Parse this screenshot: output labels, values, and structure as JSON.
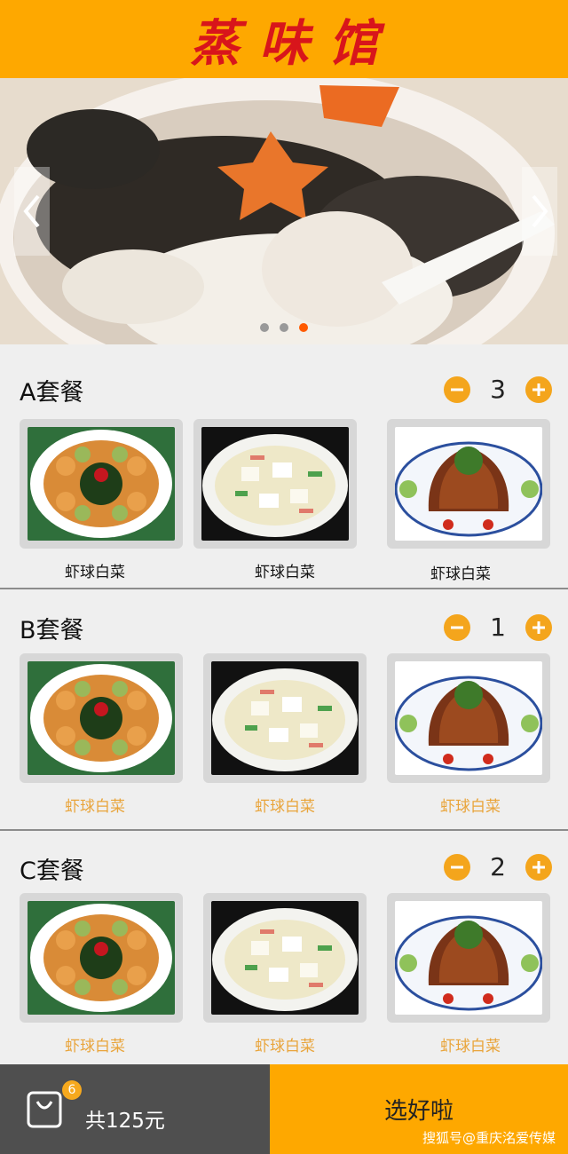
{
  "app": {
    "title": "蒸味馆"
  },
  "banner": {
    "image": "soup-photo",
    "slide_count": 3,
    "active_slide": 3
  },
  "sets": [
    {
      "name": "A套餐",
      "quantity": "3",
      "dishes": [
        {
          "label": "虾球白菜",
          "image": "shrimp-ball-broccoli-photo"
        },
        {
          "label": "虾球白菜",
          "image": "tofu-shrimp-photo"
        },
        {
          "label": "虾球白菜",
          "image": "braised-pork-photo"
        }
      ],
      "label_color": "#111111"
    },
    {
      "name": "B套餐",
      "quantity": "1",
      "dishes": [
        {
          "label": "虾球白菜",
          "image": "shrimp-ball-broccoli-photo"
        },
        {
          "label": "虾球白菜",
          "image": "tofu-shrimp-photo"
        },
        {
          "label": "虾球白菜",
          "image": "braised-pork-photo"
        }
      ],
      "label_color": "#e9a43a"
    },
    {
      "name": "C套餐",
      "quantity": "2",
      "dishes": [
        {
          "label": "虾球白菜",
          "image": "shrimp-ball-broccoli-photo"
        },
        {
          "label": "虾球白菜",
          "image": "tofu-shrimp-photo"
        },
        {
          "label": "虾球白菜",
          "image": "braised-pork-photo"
        }
      ],
      "label_color": "#e9a43a"
    }
  ],
  "cart": {
    "badge": "6",
    "total": "共125元"
  },
  "submit_label": "选好啦",
  "watermark": "搜狐号@重庆洺爱传媒",
  "colors": {
    "accent": "#fea800",
    "title": "#d8151b",
    "button": "#f4a51c",
    "footer_dark": "#4f4f4f"
  }
}
